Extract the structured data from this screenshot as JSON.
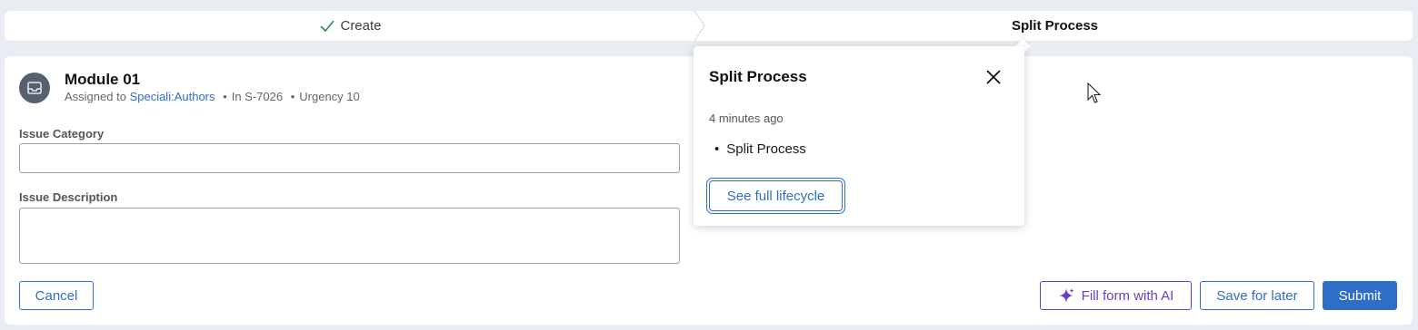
{
  "stepper": {
    "steps": [
      {
        "label": "Create",
        "status": "completed"
      },
      {
        "label": "Split Process",
        "status": "current"
      }
    ]
  },
  "case": {
    "title": "Module 01",
    "assigned_prefix": "Assigned to",
    "assignee": "Speciali:Authors",
    "in_label": "In S-7026",
    "urgency_label": "Urgency 10",
    "separator": "•",
    "icon": "inbox-icon"
  },
  "form": {
    "issue_category_label": "Issue Category",
    "issue_category_value": "",
    "issue_description_label": "Issue Description",
    "issue_description_value": ""
  },
  "actions": {
    "cancel": "Cancel",
    "fill_ai": "Fill form with AI",
    "save_later": "Save for later",
    "submit": "Submit"
  },
  "popover": {
    "title": "Split Process",
    "time": "4 minutes ago",
    "items": [
      "Split Process"
    ],
    "button": "See full lifecycle"
  },
  "colors": {
    "accent": "#2f6ec7",
    "ai": "#6b3fc4",
    "check": "#2e8b57",
    "background": "#e9ecf2"
  }
}
